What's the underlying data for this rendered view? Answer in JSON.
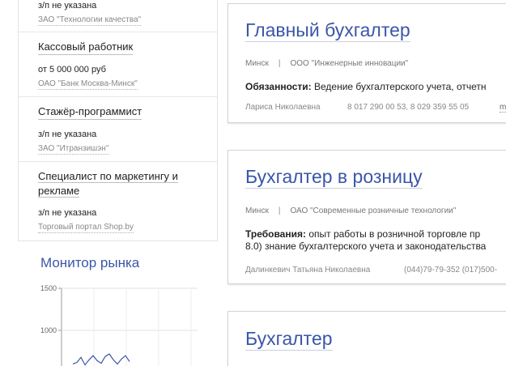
{
  "sidebar": {
    "items": [
      {
        "title": "",
        "salary": "з/п не указана",
        "company": "ЗАО \"Технологии качества\""
      },
      {
        "title": "Кассовый работник",
        "salary": "от 5 000 000 руб",
        "company": "ОАО \"Банк Москва-Минск\""
      },
      {
        "title": "Стажёр-программист",
        "salary": "з/п не указана",
        "company": "ЗАО \"Итранзишэн\""
      },
      {
        "title": "Специалист по маркетингу и рекламе",
        "salary": "з/п не указана",
        "company": "Торговый портал Shop.by"
      }
    ]
  },
  "monitor": {
    "title": "Монитор рынка",
    "chart_data": {
      "type": "line",
      "title": "",
      "xlabel": "",
      "ylabel": "",
      "y_ticks": [
        "1500",
        "1000"
      ],
      "ylim": [
        0,
        1500
      ],
      "grid": true,
      "series": [
        {
          "values": [
            600,
            620,
            680,
            590,
            650,
            700,
            640,
            610,
            690,
            720,
            650,
            600,
            660,
            700,
            630
          ]
        }
      ],
      "line_color": "#3a56a8"
    }
  },
  "vacancies": [
    {
      "title": "Главный бухгалтер",
      "city": "Минск",
      "separator": "|",
      "company": "ООО \"Инженерные инновации\"",
      "desc_label": "Обязанности:",
      "desc_text": " Ведение бухгалтерского учета, отчетн",
      "contact_name": "Лариса Николаевна",
      "contact_phone": "8 017 290 00 53, 8 029 359 55 05",
      "more": "m"
    },
    {
      "title": "Бухгалтер в розницу",
      "city": "Минск",
      "separator": "|",
      "company": "ОАО \"Современные розничные технологии\"",
      "desc_label": "Требования:",
      "desc_text_1": " опыт работы в розничной торговле пр",
      "desc_text_2": "8.0) знание бухгалтерского учета и законодательства",
      "contact_name": "Далинкевич Татьяна Николаевна",
      "contact_phone": "(044)79-79-352 (017)500-"
    },
    {
      "title": "Бухгалтер"
    }
  ]
}
